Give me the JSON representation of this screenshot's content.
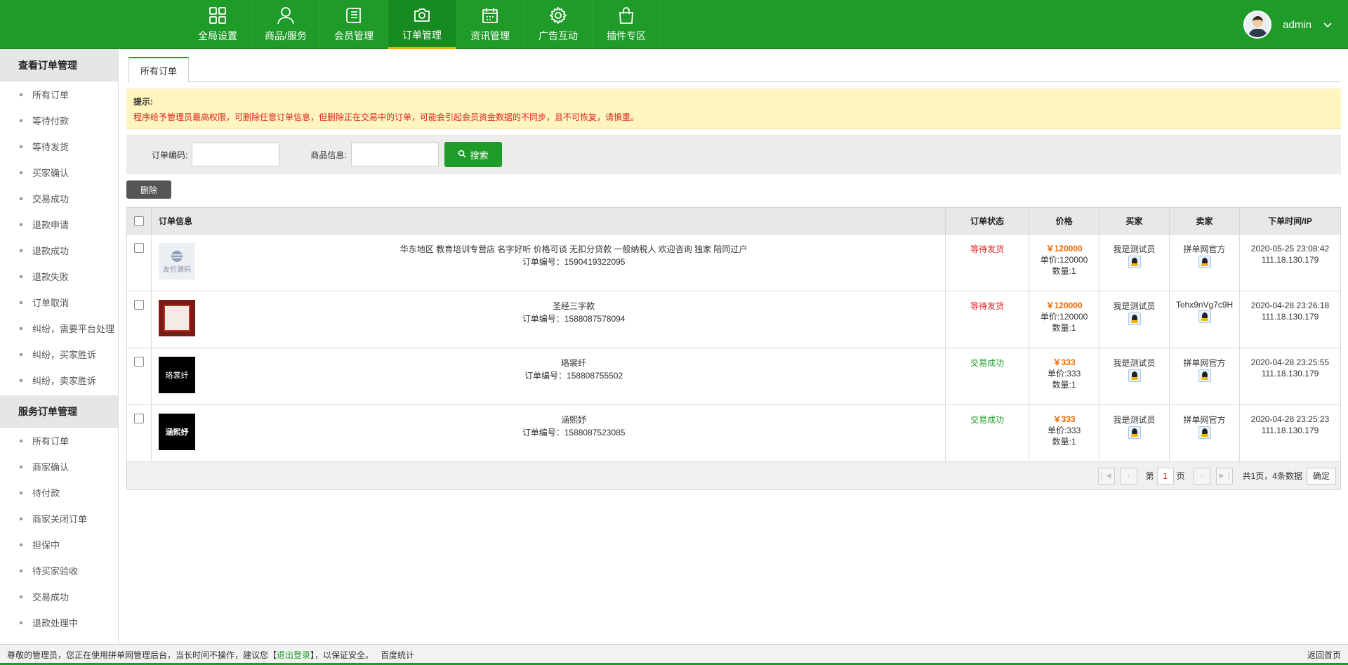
{
  "nav": [
    {
      "label": "全局设置",
      "icon": "grid-icon"
    },
    {
      "label": "商品/服务",
      "icon": "user-icon"
    },
    {
      "label": "会员管理",
      "icon": "book-icon"
    },
    {
      "label": "订单管理",
      "icon": "camera-icon",
      "active": true
    },
    {
      "label": "资讯管理",
      "icon": "calendar-icon"
    },
    {
      "label": "广告互动",
      "icon": "gear-icon"
    },
    {
      "label": "插件专区",
      "icon": "bag-icon"
    }
  ],
  "user": {
    "name": "admin"
  },
  "sidebar": {
    "group1": {
      "title": "查看订单管理",
      "items": [
        "所有订单",
        "等待付款",
        "等待发货",
        "买家确认",
        "交易成功",
        "退款申请",
        "退款成功",
        "退款失败",
        "订单取消",
        "纠纷，需要平台处理",
        "纠纷，买家胜诉",
        "纠纷，卖家胜诉"
      ]
    },
    "group2": {
      "title": "服务订单管理",
      "items": [
        "所有订单",
        "商家确认",
        "待付款",
        "商家关闭订单",
        "担保中",
        "待买家验收",
        "交易成功",
        "退款处理中"
      ]
    }
  },
  "tab": {
    "label": "所有订单"
  },
  "notice": {
    "title": "提示:",
    "message": "程序给予管理员最高权限，可删除任意订单信息，但删除正在交易中的订单，可能会引起会员资金数据的不同步，且不可恢复，请慎重。"
  },
  "search": {
    "order_no_label": "订单编码:",
    "goods_label": "商品信息:",
    "button": "搜索"
  },
  "delete_button": "删除",
  "table": {
    "headers": {
      "info": "订单信息",
      "status": "订单状态",
      "price": "价格",
      "buyer": "买家",
      "seller": "卖家",
      "time": "下单时间/IP"
    },
    "rows": [
      {
        "thumb_text": "友价源码",
        "name": "华东地区 教育培训专营店 名字好听 价格可谈 无扣分贷款 一般纳税人 欢迎咨询 独家 陪同过户",
        "order_no": "订单编号：1590419322095",
        "status": "等待发货",
        "status_color": "#e02020",
        "total": "￥120000",
        "unit": "单价:120000",
        "qty": "数量:1",
        "buyer": "我是测试员",
        "seller": "拼单网官方",
        "time": "2020-05-25 23:08:42",
        "ip": "111.18.130.179"
      },
      {
        "thumb_text": "",
        "name": "圣经三字款",
        "order_no": "订单编号：1588087578094",
        "status": "等待发货",
        "status_color": "#e02020",
        "total": "￥120000",
        "unit": "单价:120000",
        "qty": "数量:1",
        "buyer": "我是测试员",
        "seller": "Tehx9nVg7c9H",
        "time": "2020-04-28 23:26:18",
        "ip": "111.18.130.179"
      },
      {
        "thumb_text": "珞裳纤",
        "name": "珞裳纤",
        "order_no": "订单编号：158808755502",
        "status": "交易成功",
        "status_color": "#1e9b28",
        "total": "￥333",
        "unit": "单价:333",
        "qty": "数量:1",
        "buyer": "我是测试员",
        "seller": "拼单网官方",
        "time": "2020-04-28 23:25:55",
        "ip": "111.18.130.179"
      },
      {
        "thumb_text": "涵熙妤",
        "name": "涵熙妤",
        "order_no": "订单编号：1588087523085",
        "status": "交易成功",
        "status_color": "#1e9b28",
        "total": "￥333",
        "unit": "单价:333",
        "qty": "数量:1",
        "buyer": "我是测试员",
        "seller": "拼单网官方",
        "time": "2020-04-28 23:25:23",
        "ip": "111.18.130.179"
      }
    ]
  },
  "pager": {
    "prefix": "第",
    "page": "1",
    "suffix": "页",
    "summary": "共1页，4条数据",
    "confirm": "确定"
  },
  "footer": {
    "text1": "尊敬的管理员，您正在使用拼单网管理后台，当长时间不操作，建议您【",
    "logout": "退出登录",
    "text2": "】，以保证安全。",
    "stats": "百度统计",
    "home": "返回首页"
  },
  "colors": {
    "brand": "#1e9b28",
    "warning": "#e02020",
    "price": "#f06a00"
  }
}
